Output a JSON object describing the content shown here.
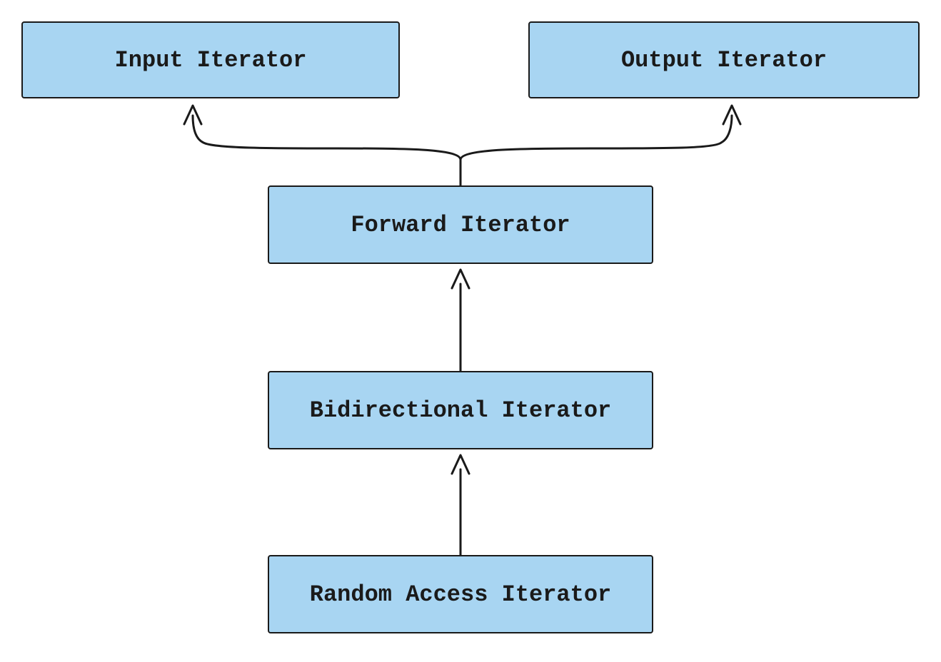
{
  "nodes": {
    "input": {
      "label": "Input Iterator"
    },
    "output": {
      "label": "Output Iterator"
    },
    "forward": {
      "label": "Forward Iterator"
    },
    "bidirectional": {
      "label": "Bidirectional Iterator"
    },
    "random": {
      "label": "Random Access Iterator"
    }
  },
  "edges": [
    {
      "from": "forward",
      "to": [
        "input",
        "output"
      ],
      "style": "fork-up"
    },
    {
      "from": "bidirectional",
      "to": [
        "forward"
      ],
      "style": "straight-up"
    },
    {
      "from": "random",
      "to": [
        "bidirectional"
      ],
      "style": "straight-up"
    }
  ],
  "colors": {
    "box_fill": "#a8d5f2",
    "stroke": "#1a1a1a",
    "bg": "#ffffff"
  }
}
